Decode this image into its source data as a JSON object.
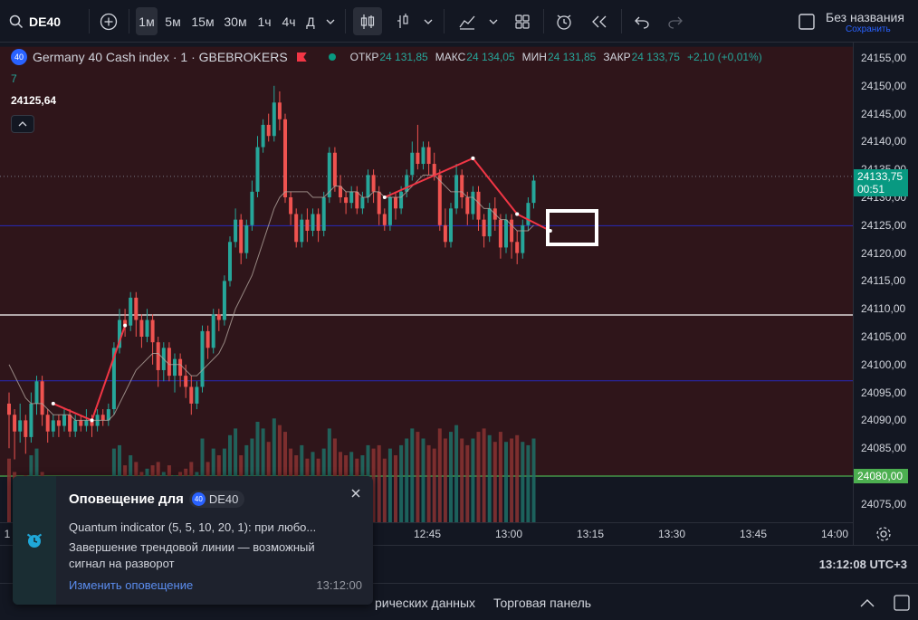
{
  "toolbar": {
    "symbol": "DE40",
    "intervals": [
      "1м",
      "5м",
      "15м",
      "30м",
      "1ч",
      "4ч",
      "Д"
    ],
    "active_interval": "1м",
    "layout_name": "Без названия",
    "save_label": "Сохранить"
  },
  "legend": {
    "badge": "40",
    "title": "Germany 40 Cash index · 1 · GBEBROKERS",
    "open_label": "ОТКР",
    "open": "24 131,85",
    "high_label": "МАКС",
    "high": "24 134,05",
    "low_label": "МИН",
    "low": "24 131,85",
    "close_label": "ЗАКР",
    "close": "24 133,75",
    "change": "+2,10 (+0,01%)",
    "sub_value": "7",
    "indicator_value": "24125,64"
  },
  "price_scale": {
    "ticks": [
      "24155,00",
      "24150,00",
      "24145,00",
      "24140,00",
      "24135,00",
      "24130,00",
      "24125,00",
      "24120,00",
      "24115,00",
      "24110,00",
      "24105,00",
      "24100,00",
      "24095,00",
      "24090,00",
      "24085,00",
      "24080,00",
      "24075,00"
    ],
    "current_price": "24133,75",
    "countdown": "00:51",
    "level_price": "24080,00"
  },
  "time_axis": {
    "labels": [
      "12:45",
      "13:00",
      "13:15",
      "13:30",
      "13:45",
      "14:00"
    ],
    "left_label": "1",
    "clock": "13:12:08 UTC+3"
  },
  "bottom_bar": {
    "tab_partial": "рических данных",
    "tab_trading": "Торговая панель"
  },
  "notification": {
    "title": "Оповещение для",
    "chip_badge": "40",
    "chip_symbol": "DE40",
    "line1": "Quantum indicator (5, 5, 10, 20, 1): при любо...",
    "line2": "Завершение трендовой линии — возможный сигнал на разворот",
    "link": "Изменить оповещение",
    "time": "13:12:00"
  },
  "colors": {
    "up": "#26a69a",
    "down": "#ef5350",
    "bg": "#131722",
    "zone": "#3a1518",
    "blue_line": "#2727a8",
    "green_level": "#4caf50"
  },
  "chart_data": {
    "type": "candlestick",
    "symbol": "DE40",
    "interval": "1m",
    "ylim": [
      24072,
      24157
    ],
    "candles": [
      {
        "o": 24093,
        "c": 24091,
        "h": 24095,
        "l": 24085
      },
      {
        "o": 24091,
        "c": 24088,
        "h": 24092,
        "l": 24083
      },
      {
        "o": 24088,
        "c": 24090,
        "h": 24093,
        "l": 24086
      },
      {
        "o": 24090,
        "c": 24087,
        "h": 24091,
        "l": 24084
      },
      {
        "o": 24087,
        "c": 24093,
        "h": 24095,
        "l": 24086
      },
      {
        "o": 24093,
        "c": 24097,
        "h": 24098,
        "l": 24091
      },
      {
        "o": 24097,
        "c": 24091,
        "h": 24098,
        "l": 24089
      },
      {
        "o": 24091,
        "c": 24088,
        "h": 24092,
        "l": 24086
      },
      {
        "o": 24088,
        "c": 24090,
        "h": 24091,
        "l": 24087
      },
      {
        "o": 24090,
        "c": 24089,
        "h": 24091,
        "l": 24087
      },
      {
        "o": 24089,
        "c": 24091,
        "h": 24092,
        "l": 24088
      },
      {
        "o": 24091,
        "c": 24088,
        "h": 24092,
        "l": 24087
      },
      {
        "o": 24088,
        "c": 24090,
        "h": 24091,
        "l": 24087
      },
      {
        "o": 24090,
        "c": 24089,
        "h": 24091,
        "l": 24088
      },
      {
        "o": 24089,
        "c": 24090,
        "h": 24092,
        "l": 24088
      },
      {
        "o": 24090,
        "c": 24089,
        "h": 24091,
        "l": 24087
      },
      {
        "o": 24089,
        "c": 24091,
        "h": 24092,
        "l": 24088
      },
      {
        "o": 24091,
        "c": 24090,
        "h": 24092,
        "l": 24089
      },
      {
        "o": 24090,
        "c": 24092,
        "h": 24093,
        "l": 24089
      },
      {
        "o": 24092,
        "c": 24103,
        "h": 24104,
        "l": 24091
      },
      {
        "o": 24103,
        "c": 24108,
        "h": 24110,
        "l": 24102
      },
      {
        "o": 24108,
        "c": 24107,
        "h": 24110,
        "l": 24105
      },
      {
        "o": 24107,
        "c": 24112,
        "h": 24113,
        "l": 24106
      },
      {
        "o": 24112,
        "c": 24108,
        "h": 24113,
        "l": 24105
      },
      {
        "o": 24108,
        "c": 24105,
        "h": 24109,
        "l": 24103
      },
      {
        "o": 24105,
        "c": 24108,
        "h": 24110,
        "l": 24104
      },
      {
        "o": 24108,
        "c": 24104,
        "h": 24109,
        "l": 24100
      },
      {
        "o": 24104,
        "c": 24099,
        "h": 24105,
        "l": 24096
      },
      {
        "o": 24099,
        "c": 24103,
        "h": 24104,
        "l": 24097
      },
      {
        "o": 24103,
        "c": 24098,
        "h": 24104,
        "l": 24097
      },
      {
        "o": 24098,
        "c": 24101,
        "h": 24102,
        "l": 24095
      },
      {
        "o": 24101,
        "c": 24098,
        "h": 24102,
        "l": 24096
      },
      {
        "o": 24098,
        "c": 24096,
        "h": 24100,
        "l": 24094
      },
      {
        "o": 24096,
        "c": 24093,
        "h": 24098,
        "l": 24091
      },
      {
        "o": 24093,
        "c": 24096,
        "h": 24097,
        "l": 24092
      },
      {
        "o": 24096,
        "c": 24106,
        "h": 24107,
        "l": 24095
      },
      {
        "o": 24106,
        "c": 24103,
        "h": 24107,
        "l": 24101
      },
      {
        "o": 24103,
        "c": 24109,
        "h": 24110,
        "l": 24102
      },
      {
        "o": 24109,
        "c": 24108,
        "h": 24110,
        "l": 24106
      },
      {
        "o": 24108,
        "c": 24115,
        "h": 24116,
        "l": 24107
      },
      {
        "o": 24115,
        "c": 24122,
        "h": 24123,
        "l": 24114
      },
      {
        "o": 24122,
        "c": 24126,
        "h": 24128,
        "l": 24121
      },
      {
        "o": 24126,
        "c": 24120,
        "h": 24127,
        "l": 24118
      },
      {
        "o": 24120,
        "c": 24125,
        "h": 24126,
        "l": 24119
      },
      {
        "o": 24125,
        "c": 24131,
        "h": 24133,
        "l": 24124
      },
      {
        "o": 24131,
        "c": 24139,
        "h": 24141,
        "l": 24130
      },
      {
        "o": 24139,
        "c": 24143,
        "h": 24144,
        "l": 24138
      },
      {
        "o": 24143,
        "c": 24141,
        "h": 24145,
        "l": 24140
      },
      {
        "o": 24141,
        "c": 24147,
        "h": 24150,
        "l": 24140
      },
      {
        "o": 24147,
        "c": 24144,
        "h": 24149,
        "l": 24142
      },
      {
        "o": 24144,
        "c": 24130,
        "h": 24145,
        "l": 24129
      },
      {
        "o": 24130,
        "c": 24127,
        "h": 24131,
        "l": 24125
      },
      {
        "o": 24127,
        "c": 24122,
        "h": 24128,
        "l": 24121
      },
      {
        "o": 24122,
        "c": 24126,
        "h": 24127,
        "l": 24121
      },
      {
        "o": 24126,
        "c": 24124,
        "h": 24128,
        "l": 24122
      },
      {
        "o": 24124,
        "c": 24127,
        "h": 24128,
        "l": 24123
      },
      {
        "o": 24127,
        "c": 24124,
        "h": 24128,
        "l": 24122
      },
      {
        "o": 24124,
        "c": 24130,
        "h": 24131,
        "l": 24123
      },
      {
        "o": 24130,
        "c": 24138,
        "h": 24139,
        "l": 24129
      },
      {
        "o": 24138,
        "c": 24132,
        "h": 24139,
        "l": 24131
      },
      {
        "o": 24132,
        "c": 24130,
        "h": 24134,
        "l": 24129
      },
      {
        "o": 24130,
        "c": 24129,
        "h": 24131,
        "l": 24127
      },
      {
        "o": 24129,
        "c": 24131,
        "h": 24132,
        "l": 24128
      },
      {
        "o": 24131,
        "c": 24128,
        "h": 24132,
        "l": 24127
      },
      {
        "o": 24128,
        "c": 24130,
        "h": 24131,
        "l": 24127
      },
      {
        "o": 24130,
        "c": 24134,
        "h": 24135,
        "l": 24129
      },
      {
        "o": 24134,
        "c": 24131,
        "h": 24135,
        "l": 24129
      },
      {
        "o": 24131,
        "c": 24127,
        "h": 24132,
        "l": 24125
      },
      {
        "o": 24127,
        "c": 24125,
        "h": 24128,
        "l": 24124
      },
      {
        "o": 24125,
        "c": 24130,
        "h": 24131,
        "l": 24124
      },
      {
        "o": 24130,
        "c": 24128,
        "h": 24131,
        "l": 24126
      },
      {
        "o": 24128,
        "c": 24131,
        "h": 24132,
        "l": 24127
      },
      {
        "o": 24131,
        "c": 24134,
        "h": 24135,
        "l": 24130
      },
      {
        "o": 24134,
        "c": 24138,
        "h": 24140,
        "l": 24133
      },
      {
        "o": 24138,
        "c": 24136,
        "h": 24143,
        "l": 24135
      },
      {
        "o": 24136,
        "c": 24139,
        "h": 24140,
        "l": 24135
      },
      {
        "o": 24139,
        "c": 24136,
        "h": 24140,
        "l": 24134
      },
      {
        "o": 24136,
        "c": 24134,
        "h": 24138,
        "l": 24133
      },
      {
        "o": 24134,
        "c": 24125,
        "h": 24135,
        "l": 24124
      },
      {
        "o": 24125,
        "c": 24122,
        "h": 24128,
        "l": 24121
      },
      {
        "o": 24122,
        "c": 24128,
        "h": 24129,
        "l": 24121
      },
      {
        "o": 24128,
        "c": 24134,
        "h": 24136,
        "l": 24127
      },
      {
        "o": 24134,
        "c": 24130,
        "h": 24135,
        "l": 24128
      },
      {
        "o": 24130,
        "c": 24127,
        "h": 24131,
        "l": 24125
      },
      {
        "o": 24127,
        "c": 24131,
        "h": 24132,
        "l": 24126
      },
      {
        "o": 24131,
        "c": 24126,
        "h": 24132,
        "l": 24124
      },
      {
        "o": 24126,
        "c": 24123,
        "h": 24127,
        "l": 24121
      },
      {
        "o": 24123,
        "c": 24128,
        "h": 24129,
        "l": 24122
      },
      {
        "o": 24128,
        "c": 24126,
        "h": 24130,
        "l": 24124
      },
      {
        "o": 24126,
        "c": 24121,
        "h": 24127,
        "l": 24119
      },
      {
        "o": 24121,
        "c": 24126,
        "h": 24127,
        "l": 24120
      },
      {
        "o": 24126,
        "c": 24122,
        "h": 24127,
        "l": 24119
      },
      {
        "o": 24122,
        "c": 24120,
        "h": 24124,
        "l": 24118
      },
      {
        "o": 24120,
        "c": 24125,
        "h": 24126,
        "l": 24119
      },
      {
        "o": 24125,
        "c": 24129,
        "h": 24130,
        "l": 24124
      },
      {
        "o": 24129,
        "c": 24133,
        "h": 24134,
        "l": 24128
      }
    ],
    "volume": [
      38,
      30,
      26,
      28,
      40,
      44,
      30,
      24,
      22,
      20,
      22,
      24,
      20,
      18,
      22,
      20,
      24,
      22,
      24,
      44,
      46,
      34,
      40,
      36,
      30,
      32,
      34,
      36,
      30,
      34,
      28,
      30,
      32,
      36,
      30,
      50,
      36,
      44,
      40,
      44,
      52,
      56,
      40,
      46,
      50,
      60,
      56,
      48,
      62,
      58,
      54,
      44,
      40,
      46,
      38,
      42,
      38,
      44,
      56,
      50,
      42,
      40,
      42,
      38,
      40,
      46,
      44,
      46,
      38,
      44,
      40,
      46,
      50,
      56,
      54,
      50,
      46,
      44,
      56,
      50,
      54,
      58,
      50,
      46,
      50,
      54,
      56,
      52,
      48,
      54,
      48,
      50,
      52,
      48,
      46,
      50
    ],
    "moving_average": [
      24100,
      24098,
      24096,
      24094,
      24093,
      24093,
      24093,
      24092,
      24091,
      24091,
      24091,
      24091,
      24090,
      24090,
      24090,
      24090,
      24090,
      24090,
      24090,
      24091,
      24093,
      24095,
      24097,
      24099,
      24100,
      24101,
      24102,
      24102,
      24101,
      24100,
      24100,
      24100,
      24099,
      24098,
      24098,
      24099,
      24100,
      24101,
      24102,
      24104,
      24107,
      24110,
      24112,
      24114,
      24116,
      24119,
      24122,
      24125,
      24128,
      24130,
      24131,
      24131,
      24131,
      24131,
      24131,
      24130,
      24130,
      24130,
      24131,
      24132,
      24132,
      24131,
      24131,
      24131,
      24130,
      24130,
      24131,
      24131,
      24130,
      24130,
      24130,
      24130,
      24131,
      24132,
      24133,
      24134,
      24134,
      24134,
      24133,
      24132,
      24131,
      24131,
      24131,
      24130,
      24130,
      24129,
      24128,
      24128,
      24127,
      24126,
      24126,
      24125,
      24124,
      24124,
      24124,
      24125
    ],
    "horizontal_lines": [
      {
        "price": 24124.9,
        "style": "blue"
      },
      {
        "price": 24108.9,
        "style": "white"
      },
      {
        "price": 24097.1,
        "style": "blue"
      },
      {
        "price": 24080.0,
        "style": "green"
      },
      {
        "price": 24133.75,
        "style": "dotted"
      }
    ],
    "zone": {
      "top": 24157,
      "bottom": 24080
    },
    "trendlines": [
      {
        "points": [
          [
            8,
            24093
          ],
          [
            15,
            24090
          ]
        ]
      },
      {
        "points": [
          [
            15,
            24090
          ],
          [
            21,
            24107
          ]
        ]
      },
      {
        "points": [
          [
            68,
            24130
          ],
          [
            84,
            24137
          ]
        ]
      },
      {
        "points": [
          [
            84,
            24137
          ],
          [
            92,
            24127
          ]
        ]
      },
      {
        "points": [
          [
            92,
            24127
          ],
          [
            98,
            24124
          ]
        ]
      }
    ]
  }
}
